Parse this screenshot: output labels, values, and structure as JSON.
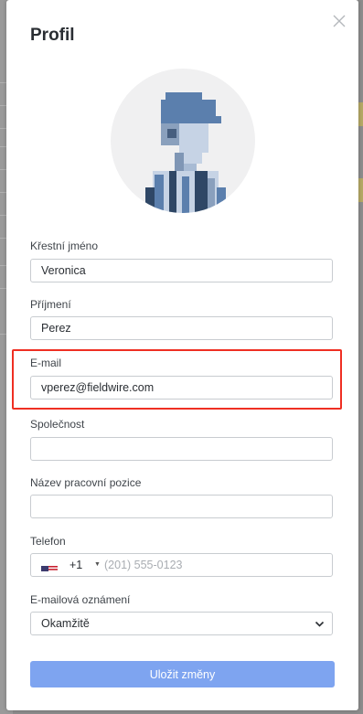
{
  "dialog": {
    "title": "Profil"
  },
  "fields": {
    "first_name": {
      "label": "Křestní jméno",
      "value": "Veronica"
    },
    "last_name": {
      "label": "Příjmení",
      "value": "Perez"
    },
    "email": {
      "label": "E-mail",
      "value": "vperez@fieldwire.com"
    },
    "company": {
      "label": "Společnost",
      "value": ""
    },
    "job_title": {
      "label": "Název pracovní pozice",
      "value": ""
    },
    "phone": {
      "label": "Telefon",
      "country_code": "+1",
      "placeholder": "(201) 555-0123",
      "flag": "us-flag-icon"
    },
    "notifications": {
      "label": "E-mailová oznámení",
      "selected": "Okamžitě"
    }
  },
  "actions": {
    "save_label": "Uložit změny",
    "save_color": "#7ea4f0"
  },
  "colors": {
    "highlight": "#ef2f22",
    "avatar_blue": "#5b7fad"
  }
}
